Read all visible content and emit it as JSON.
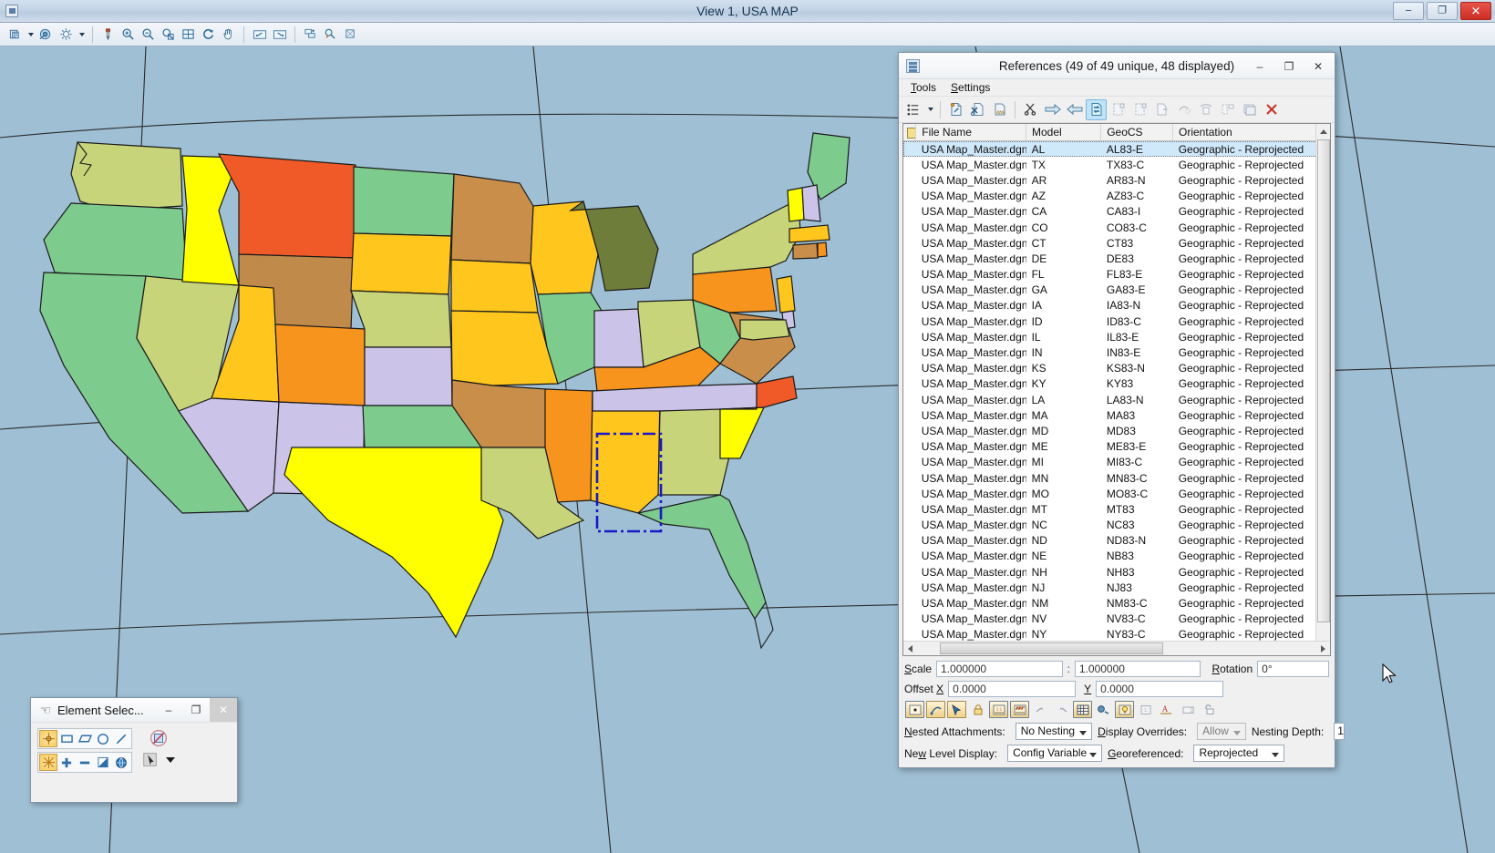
{
  "window": {
    "title": "View 1, USA MAP",
    "icon": "view-window-icon",
    "minimize_label": "–",
    "restore_label": "❐",
    "close_label": "✕"
  },
  "main_toolbar": {
    "buttons": [
      {
        "name": "view-attributes-icon",
        "tip": "View Attributes"
      },
      {
        "name": "view-attributes-dropdown-icon",
        "tip": "View Attributes Options"
      },
      {
        "name": "view-display-mode-icon",
        "tip": "View Display Mode"
      },
      {
        "name": "view-brightness-icon",
        "tip": "Adjust View Brightness"
      },
      {
        "name": "view-brightness-dropdown-icon",
        "tip": "Brightness Options"
      },
      {
        "name": "update-view-icon",
        "tip": "Update View"
      },
      {
        "name": "zoom-in-icon",
        "tip": "Zoom In"
      },
      {
        "name": "zoom-out-icon",
        "tip": "Zoom Out"
      },
      {
        "name": "window-area-icon",
        "tip": "Window Area"
      },
      {
        "name": "fit-view-icon",
        "tip": "Fit View"
      },
      {
        "name": "rotate-view-icon",
        "tip": "Rotate View"
      },
      {
        "name": "pan-view-icon",
        "tip": "Pan View"
      },
      {
        "name": "view-previous-icon",
        "tip": "View Previous"
      },
      {
        "name": "view-next-icon",
        "tip": "View Next"
      },
      {
        "name": "copy-view-icon",
        "tip": "Copy View"
      },
      {
        "name": "clip-volume-icon",
        "tip": "Clip Volume"
      },
      {
        "name": "clip-mask-icon",
        "tip": "Clip Mask"
      }
    ]
  },
  "references": {
    "title": "References (49 of 49 unique, 48 displayed)",
    "icon": "references-dialog-icon",
    "minimize_label": "–",
    "maximize_label": "❐",
    "close_label": "✕",
    "menu": [
      "Tools",
      "Settings"
    ],
    "toolbar_icons": [
      "hierarchy-list-icon",
      "hierarchy-dropdown-icon",
      "attach-reference-icon",
      "detach-reference-icon",
      "reload-reference-icon",
      "clip-reference-icon",
      "move-reference-icon",
      "copy-reference-icon",
      "exchange-reference-icon",
      "mirror-reference-icon",
      "rotate-reference-icon",
      "scale-reference-icon",
      "merge-into-master-icon",
      "make-direct-attachment-icon",
      "reference-presentation-icon",
      "activate-reference-icon",
      "detach-all-icon"
    ],
    "columns": [
      "File Name",
      "Model",
      "GeoCS",
      "Orientation"
    ],
    "rows": [
      {
        "file": "USA Map_Master.dgn",
        "model": "AL",
        "geocs": "AL83-E",
        "orientation": "Geographic - Reprojected",
        "selected": true
      },
      {
        "file": "USA Map_Master.dgn",
        "model": "TX",
        "geocs": "TX83-C",
        "orientation": "Geographic - Reprojected"
      },
      {
        "file": "USA Map_Master.dgn",
        "model": "AR",
        "geocs": "AR83-N",
        "orientation": "Geographic - Reprojected"
      },
      {
        "file": "USA Map_Master.dgn",
        "model": "AZ",
        "geocs": "AZ83-C",
        "orientation": "Geographic - Reprojected"
      },
      {
        "file": "USA Map_Master.dgn",
        "model": "CA",
        "geocs": "CA83-I",
        "orientation": "Geographic - Reprojected"
      },
      {
        "file": "USA Map_Master.dgn",
        "model": "CO",
        "geocs": "CO83-C",
        "orientation": "Geographic - Reprojected"
      },
      {
        "file": "USA Map_Master.dgn",
        "model": "CT",
        "geocs": "CT83",
        "orientation": "Geographic - Reprojected"
      },
      {
        "file": "USA Map_Master.dgn",
        "model": "DE",
        "geocs": "DE83",
        "orientation": "Geographic - Reprojected"
      },
      {
        "file": "USA Map_Master.dgn",
        "model": "FL",
        "geocs": "FL83-E",
        "orientation": "Geographic - Reprojected"
      },
      {
        "file": "USA Map_Master.dgn",
        "model": "GA",
        "geocs": "GA83-E",
        "orientation": "Geographic - Reprojected"
      },
      {
        "file": "USA Map_Master.dgn",
        "model": "IA",
        "geocs": "IA83-N",
        "orientation": "Geographic - Reprojected"
      },
      {
        "file": "USA Map_Master.dgn",
        "model": "ID",
        "geocs": "ID83-C",
        "orientation": "Geographic - Reprojected"
      },
      {
        "file": "USA Map_Master.dgn",
        "model": "IL",
        "geocs": "IL83-E",
        "orientation": "Geographic - Reprojected"
      },
      {
        "file": "USA Map_Master.dgn",
        "model": "IN",
        "geocs": "IN83-E",
        "orientation": "Geographic - Reprojected"
      },
      {
        "file": "USA Map_Master.dgn",
        "model": "KS",
        "geocs": "KS83-N",
        "orientation": "Geographic - Reprojected"
      },
      {
        "file": "USA Map_Master.dgn",
        "model": "KY",
        "geocs": "KY83",
        "orientation": "Geographic - Reprojected"
      },
      {
        "file": "USA Map_Master.dgn",
        "model": "LA",
        "geocs": "LA83-N",
        "orientation": "Geographic - Reprojected"
      },
      {
        "file": "USA Map_Master.dgn",
        "model": "MA",
        "geocs": "MA83",
        "orientation": "Geographic - Reprojected"
      },
      {
        "file": "USA Map_Master.dgn",
        "model": "MD",
        "geocs": "MD83",
        "orientation": "Geographic - Reprojected"
      },
      {
        "file": "USA Map_Master.dgn",
        "model": "ME",
        "geocs": "ME83-E",
        "orientation": "Geographic - Reprojected"
      },
      {
        "file": "USA Map_Master.dgn",
        "model": "MI",
        "geocs": "MI83-C",
        "orientation": "Geographic - Reprojected"
      },
      {
        "file": "USA Map_Master.dgn",
        "model": "MN",
        "geocs": "MN83-C",
        "orientation": "Geographic - Reprojected"
      },
      {
        "file": "USA Map_Master.dgn",
        "model": "MO",
        "geocs": "MO83-C",
        "orientation": "Geographic - Reprojected"
      },
      {
        "file": "USA Map_Master.dgn",
        "model": "MT",
        "geocs": "MT83",
        "orientation": "Geographic - Reprojected"
      },
      {
        "file": "USA Map_Master.dgn",
        "model": "NC",
        "geocs": "NC83",
        "orientation": "Geographic - Reprojected"
      },
      {
        "file": "USA Map_Master.dgn",
        "model": "ND",
        "geocs": "ND83-N",
        "orientation": "Geographic - Reprojected"
      },
      {
        "file": "USA Map_Master.dgn",
        "model": "NE",
        "geocs": "NB83",
        "orientation": "Geographic - Reprojected"
      },
      {
        "file": "USA Map_Master.dgn",
        "model": "NH",
        "geocs": "NH83",
        "orientation": "Geographic - Reprojected"
      },
      {
        "file": "USA Map_Master.dgn",
        "model": "NJ",
        "geocs": "NJ83",
        "orientation": "Geographic - Reprojected"
      },
      {
        "file": "USA Map_Master.dgn",
        "model": "NM",
        "geocs": "NM83-C",
        "orientation": "Geographic - Reprojected"
      },
      {
        "file": "USA Map_Master.dgn",
        "model": "NV",
        "geocs": "NV83-C",
        "orientation": "Geographic - Reprojected"
      },
      {
        "file": "USA Map_Master.dgn",
        "model": "NY",
        "geocs": "NY83-C",
        "orientation": "Geographic - Reprojected"
      }
    ],
    "form": {
      "scale_label": "Scale",
      "scale_master": "1.000000",
      "scale_ref": "1.000000",
      "scale_separator": ":",
      "rotation_label": "Rotation",
      "rotation_value": "0°",
      "offset_label": "Offset",
      "offset_x_label": "X",
      "offset_x_value": "0.0000",
      "offset_y_label": "Y",
      "offset_y_value": "0.0000",
      "toggle_icons": [
        "display-toggle-icon",
        "snap-toggle-icon",
        "locate-toggle-icon",
        "lock-toggle-icon",
        "true-scale-toggle-icon",
        "line-style-scale-toggle-icon",
        "plot-toggle-icon",
        "clip-back-toggle-icon",
        "clip-front-toggle-icon",
        "display-raster-toggle-icon",
        "use-lights-toggle-icon",
        "level-overrides-toggle-icon",
        "new-level-display-toggle-icon",
        "annotation-scale-toggle-icon",
        "print-toggle-icon",
        "unlock-toggle-icon"
      ],
      "nested_attachments_label": "Nested Attachments:",
      "nested_attachments_value": "No Nesting",
      "display_overrides_label": "Display Overrides:",
      "display_overrides_value": "Allow",
      "nesting_depth_label": "Nesting Depth:",
      "nesting_depth_value": "1",
      "new_level_display_label": "New Level Display:",
      "new_level_display_value": "Config Variable",
      "georeferenced_label": "Georeferenced:",
      "georeferenced_value": "Reprojected"
    }
  },
  "element_selection": {
    "title": "Element Selec...",
    "icon": "hand-tool-icon",
    "minimize_label": "–",
    "maximize_label": "❐",
    "close_label": "✕",
    "method_icons": [
      "select-individual-icon",
      "select-block-icon",
      "select-shape-icon",
      "select-circle-icon",
      "select-line-icon"
    ],
    "mode_icons": [
      "mode-new-icon",
      "mode-add-icon",
      "mode-subtract-icon",
      "mode-invert-icon",
      "mode-clear-all-icon"
    ],
    "right_icons": [
      "no-selection-icon",
      "selection-pointer-icon"
    ],
    "dropdown_icon": "chevron-down-icon"
  },
  "map": {
    "name": "usa-state-map",
    "background_color": "#9fc0d4",
    "selection_outline_color": "#1818c8",
    "selected_state": "AL",
    "states": [
      {
        "code": "WA",
        "color": "#c8d47a"
      },
      {
        "code": "OR",
        "color": "#7ecb8e"
      },
      {
        "code": "CA",
        "color": "#7ecb8e"
      },
      {
        "code": "NV",
        "color": "#c8d47a"
      },
      {
        "code": "ID",
        "color": "#ffff00"
      },
      {
        "code": "MT",
        "color": "#f05a28"
      },
      {
        "code": "WY",
        "color": "#c08a4a"
      },
      {
        "code": "UT",
        "color": "#ffc61e"
      },
      {
        "code": "AZ",
        "color": "#cbc4e8"
      },
      {
        "code": "NM",
        "color": "#cbc4e8"
      },
      {
        "code": "CO",
        "color": "#f7941e"
      },
      {
        "code": "ND",
        "color": "#7ecb8e"
      },
      {
        "code": "SD",
        "color": "#ffc61e"
      },
      {
        "code": "NE",
        "color": "#c8d47a"
      },
      {
        "code": "KS",
        "color": "#cbc4e8"
      },
      {
        "code": "OK",
        "color": "#7ecb8e"
      },
      {
        "code": "TX",
        "color": "#ffff00"
      },
      {
        "code": "MN",
        "color": "#c98f4a"
      },
      {
        "code": "IA",
        "color": "#ffc61e"
      },
      {
        "code": "MO",
        "color": "#ffc61e"
      },
      {
        "code": "AR",
        "color": "#c98f4a"
      },
      {
        "code": "LA",
        "color": "#c8d47a"
      },
      {
        "code": "WI",
        "color": "#ffc61e"
      },
      {
        "code": "IL",
        "color": "#7ecb8e"
      },
      {
        "code": "MS",
        "color": "#f7941e"
      },
      {
        "code": "AL",
        "color": "#ffc61e"
      },
      {
        "code": "MI",
        "color": "#6f7d3a"
      },
      {
        "code": "IN",
        "color": "#cbc4e8"
      },
      {
        "code": "KY",
        "color": "#f7941e"
      },
      {
        "code": "TN",
        "color": "#cbc4e8"
      },
      {
        "code": "GA",
        "color": "#c8d47a"
      },
      {
        "code": "FL",
        "color": "#7ecb8e"
      },
      {
        "code": "OH",
        "color": "#c8d47a"
      },
      {
        "code": "WV",
        "color": "#7ecb8e"
      },
      {
        "code": "VA",
        "color": "#c98f4a"
      },
      {
        "code": "NC",
        "color": "#f05a28"
      },
      {
        "code": "SC",
        "color": "#ffff00"
      },
      {
        "code": "PA",
        "color": "#f7941e"
      },
      {
        "code": "NY",
        "color": "#c8d47a"
      },
      {
        "code": "ME",
        "color": "#7ecb8e"
      },
      {
        "code": "VT",
        "color": "#ffff00"
      },
      {
        "code": "NH",
        "color": "#cbc4e8"
      },
      {
        "code": "MA",
        "color": "#ffc61e"
      },
      {
        "code": "CT",
        "color": "#c98f4a"
      },
      {
        "code": "RI",
        "color": "#f7941e"
      },
      {
        "code": "NJ",
        "color": "#ffc61e"
      },
      {
        "code": "DE",
        "color": "#cbc4e8"
      },
      {
        "code": "MD",
        "color": "#c8d47a"
      }
    ]
  }
}
